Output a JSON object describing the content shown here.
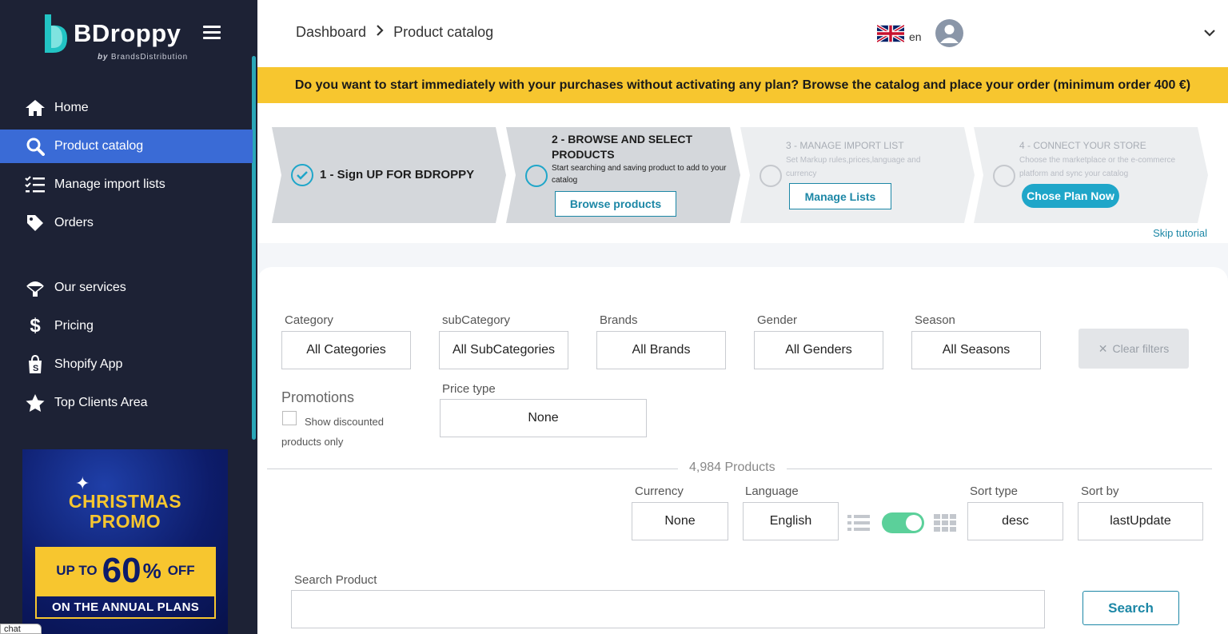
{
  "brand": {
    "name": "BDroppy",
    "by_prefix": "by",
    "by_name": "BrandsDistribution"
  },
  "sidebar": {
    "items": [
      {
        "label": "Home",
        "icon": "home-icon"
      },
      {
        "label": "Product catalog",
        "icon": "search-icon",
        "active": true
      },
      {
        "label": "Manage import lists",
        "icon": "list-check-icon"
      },
      {
        "label": "Orders",
        "icon": "tag-icon"
      },
      {
        "label": "Our services",
        "icon": "parachute-icon"
      },
      {
        "label": "Pricing",
        "icon": "dollar-icon"
      },
      {
        "label": "Shopify App",
        "icon": "shopify-bag-icon"
      },
      {
        "label": "Top Clients Area",
        "icon": "star-icon"
      }
    ],
    "promo": {
      "line1": "CHRISTMAS",
      "line2": "PROMO",
      "upto": "UP TO",
      "number": "60",
      "percent": "%",
      "off": "OFF",
      "footer": "ON THE ANNUAL PLANS"
    },
    "tooltip": "chat"
  },
  "header": {
    "breadcrumb": [
      "Dashboard",
      "Product catalog"
    ],
    "language_code": "en"
  },
  "banner": "Do you want to start immediately with your purchases without activating any plan? Browse the catalog and place your order (minimum order 400 €)",
  "steps": [
    {
      "title": "1 - Sign UP FOR BDROPPY",
      "status": "done"
    },
    {
      "title": "2 - BROWSE AND SELECT PRODUCTS",
      "desc": "Start searching and saving product to add to your catalog",
      "button": "Browse products",
      "status": "current"
    },
    {
      "title": "3 - MANAGE IMPORT LIST",
      "desc": "Set Markup rules,prices,language and currency",
      "button": "Manage Lists",
      "status": "pending"
    },
    {
      "title": "4 - CONNECT YOUR STORE",
      "desc": "Choose the marketplace or the e-commerce platform and sync your catalog",
      "button": "Chose Plan Now",
      "status": "pending"
    }
  ],
  "skip_tutorial": "Skip tutorial",
  "filters": {
    "category": {
      "label": "Category",
      "value": "All Categories"
    },
    "subcategory": {
      "label": "subCategory",
      "value": "All SubCategories"
    },
    "brands": {
      "label": "Brands",
      "value": "All Brands"
    },
    "gender": {
      "label": "Gender",
      "value": "All Genders"
    },
    "season": {
      "label": "Season",
      "value": "All Seasons"
    },
    "clear": "Clear filters",
    "promotions": {
      "label": "Promotions",
      "checkbox": "Show discounted products only",
      "checked": false
    },
    "price_type": {
      "label": "Price type",
      "value": "None"
    }
  },
  "products_count": "4,984  Products",
  "listing": {
    "currency": {
      "label": "Currency",
      "value": "None"
    },
    "language": {
      "label": "Language",
      "value": "English"
    },
    "view_toggle_on": true,
    "sort_type": {
      "label": "Sort type",
      "value": "desc"
    },
    "sort_by": {
      "label": "Sort by",
      "value": "lastUpdate"
    }
  },
  "search": {
    "label": "Search Product",
    "value": "",
    "button": "Search"
  },
  "colors": {
    "sidebar": "#1d2235",
    "active": "#3a6bd6",
    "accent": "#1c87a6",
    "banner": "#f7c62f",
    "toggle": "#5bd09a"
  }
}
